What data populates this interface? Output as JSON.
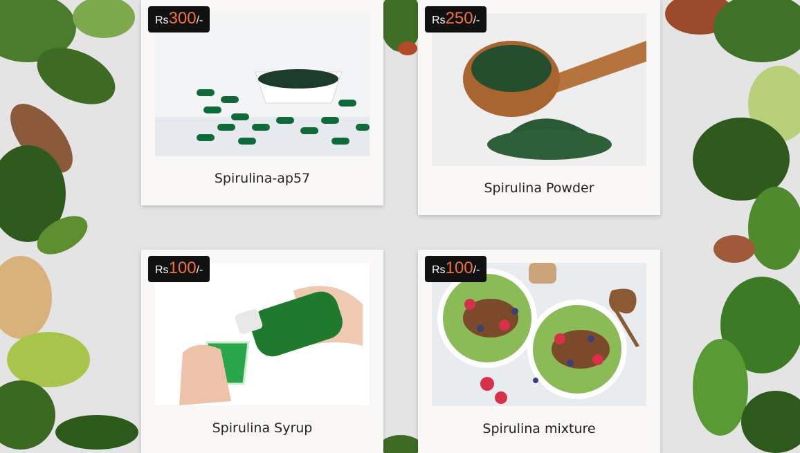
{
  "colors": {
    "background": "#e4e4e4",
    "card": "#faf8f6",
    "price_badge_bg": "#111111",
    "price_amount": "#f2703a"
  },
  "products": [
    {
      "name": "Spirulina-ap57",
      "currency": "Rs",
      "price": "300",
      "suffix": "/-",
      "image_icon": "spirulina-capsules-image"
    },
    {
      "name": "Spirulina Powder",
      "currency": "Rs",
      "price": "250",
      "suffix": "/-",
      "image_icon": "spirulina-powder-spoon-image"
    },
    {
      "name": "Spirulina Syrup",
      "currency": "Rs",
      "price": "100",
      "suffix": "/-",
      "image_icon": "spirulina-syrup-bottle-image"
    },
    {
      "name": "Spirulina mixture",
      "currency": "Rs",
      "price": "100",
      "suffix": "/-",
      "image_icon": "spirulina-smoothie-bowls-image"
    }
  ]
}
